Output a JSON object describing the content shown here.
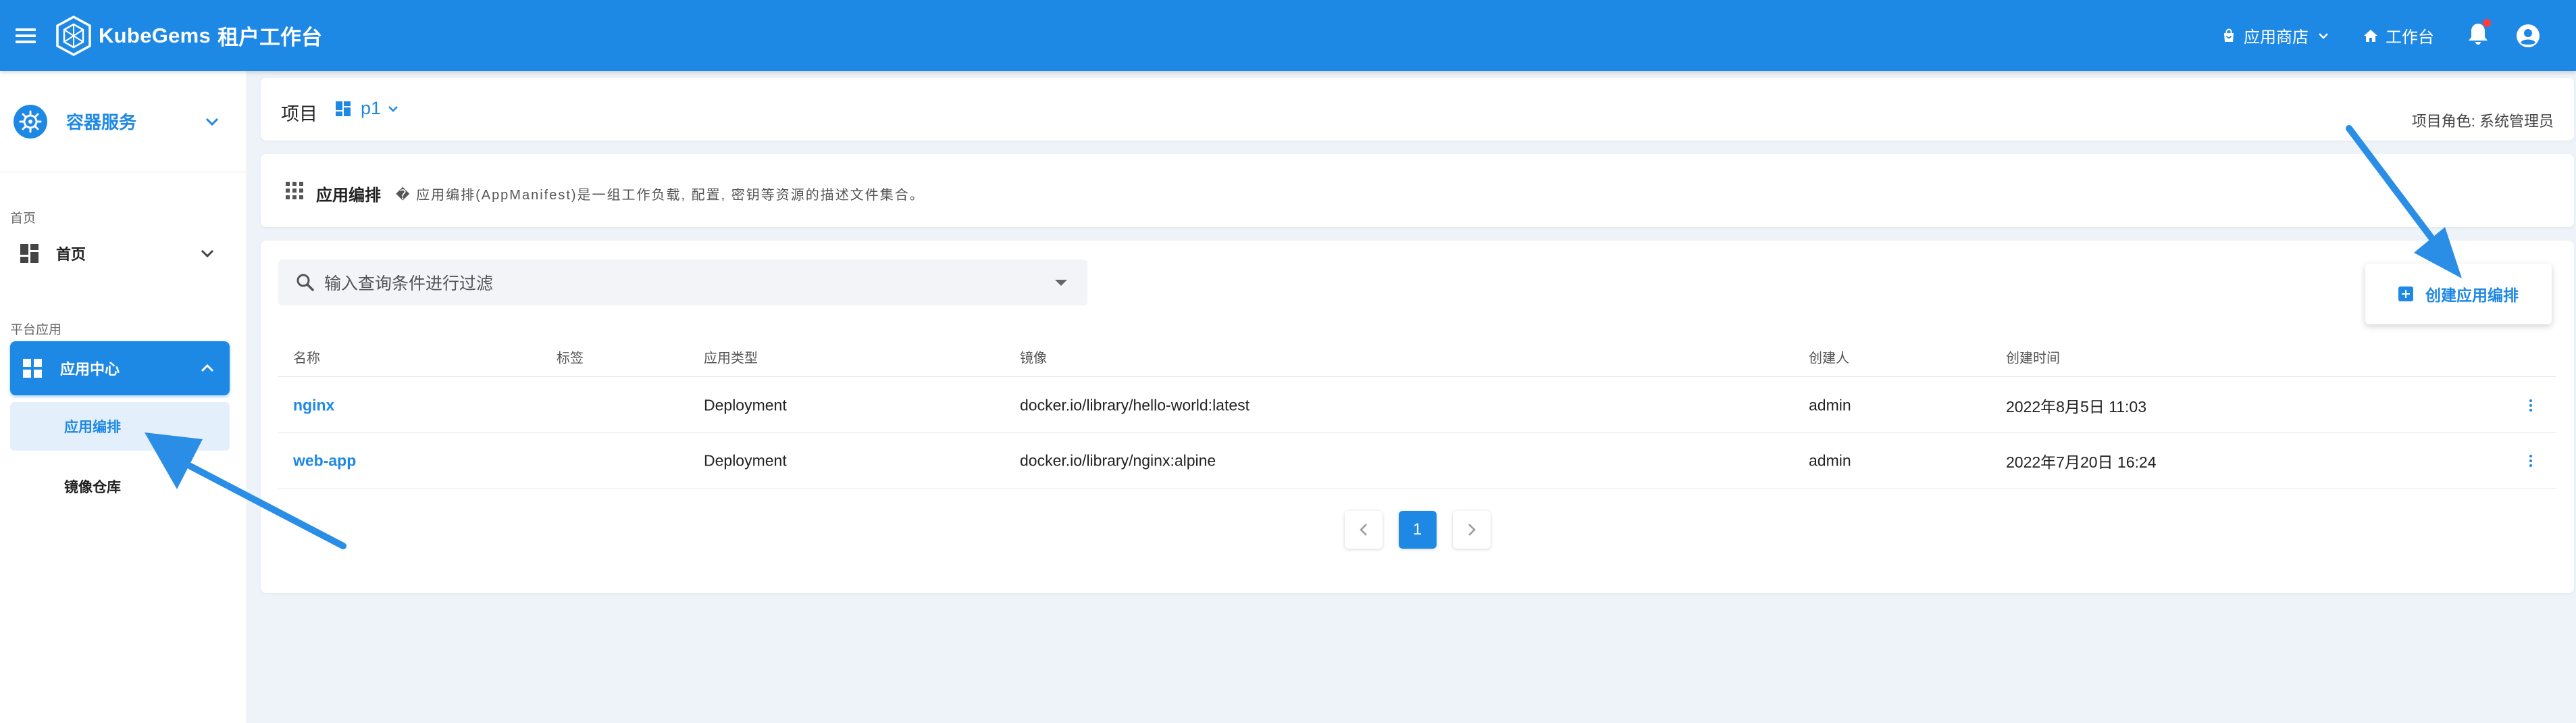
{
  "topbar": {
    "brand_name": "KubeGems",
    "brand_sub": "租户工作台",
    "app_store_label": "应用商店",
    "workspace_label": "工作台"
  },
  "sidebar": {
    "service_label": "容器服务",
    "section_home": "首页",
    "home_item": "首页",
    "section_platform": "平台应用",
    "app_center": "应用中心",
    "sub_items": [
      "应用编排",
      "镜像仓库"
    ]
  },
  "project": {
    "label": "项目",
    "name": "p1",
    "role": "项目角色: 系统管理员"
  },
  "description": {
    "title": "应用编排",
    "text": "� 应用编排(AppManifest)是一组工作负载, 配置, 密钥等资源的描述文件集合。"
  },
  "search": {
    "placeholder": "输入查询条件进行过滤"
  },
  "create_button": "创建应用编排",
  "table": {
    "headers": [
      "名称",
      "标签",
      "应用类型",
      "镜像",
      "创建人",
      "创建时间"
    ],
    "rows": [
      {
        "name": "nginx",
        "label": "",
        "type": "Deployment",
        "image": "docker.io/library/hello-world:latest",
        "creator": "admin",
        "created": "2022年8月5日 11:03"
      },
      {
        "name": "web-app",
        "label": "",
        "type": "Deployment",
        "image": "docker.io/library/nginx:alpine",
        "creator": "admin",
        "created": "2022年7月20日 16:24"
      }
    ]
  },
  "pagination": {
    "current": "1"
  },
  "colors": {
    "primary": "#1e88e5",
    "background": "#eef3f9",
    "notification_dot": "#ff3b3b"
  }
}
